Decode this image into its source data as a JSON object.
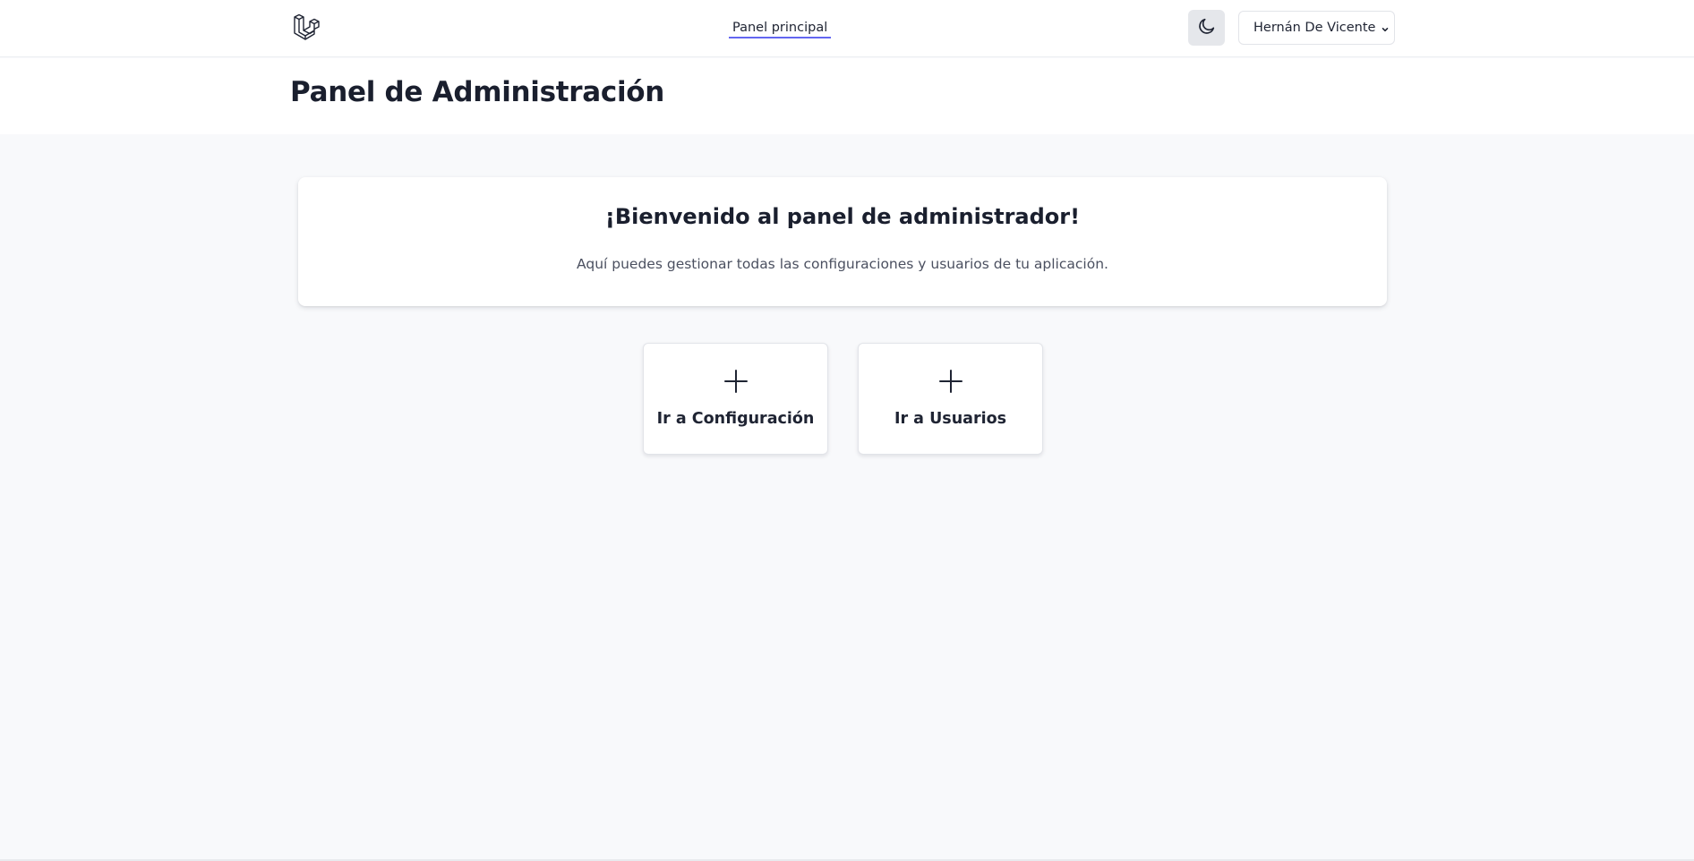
{
  "nav": {
    "logo_icon": "laravel-logo-icon",
    "links": [
      {
        "label": "Panel principal",
        "active": true
      }
    ],
    "theme_toggle_icon": "moon-icon",
    "user_menu": {
      "name": "Hernán De Vicente",
      "icon": "chevron-down-icon"
    },
    "accent_color": "#6366f1"
  },
  "header": {
    "title": "Panel de Administración"
  },
  "welcome": {
    "title": "¡Bienvenido al panel de administrador!",
    "text": "Aquí puedes gestionar todas las configuraciones y usuarios de tu aplicación."
  },
  "actions": [
    {
      "label": "Ir a Configuración",
      "icon": "plus-icon"
    },
    {
      "label": "Ir a Usuarios",
      "icon": "plus-icon"
    }
  ]
}
